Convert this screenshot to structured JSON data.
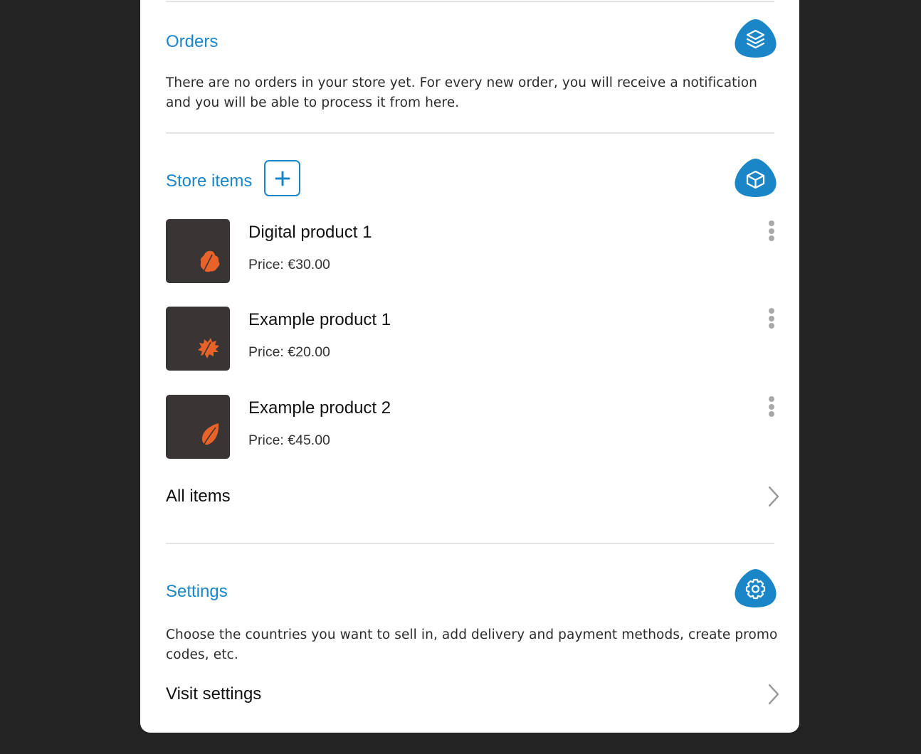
{
  "colors": {
    "accent": "#1a86c8",
    "thumb_bg": "#393534",
    "leaf": "#e8622a",
    "background": "#232323"
  },
  "orders": {
    "title": "Orders",
    "icon": "layers-icon",
    "description": "There are no orders in your store yet. For every new order, you will receive a notification and you will be able to process it from here."
  },
  "store_items": {
    "title": "Store items",
    "add_icon": "plus-icon",
    "icon": "box-icon",
    "items": [
      {
        "name": "Digital product 1",
        "price": "Price: €30.00",
        "thumb_icon": "oak-leaf-icon"
      },
      {
        "name": "Example product 1",
        "price": "Price: €20.00",
        "thumb_icon": "maple-leaf-icon"
      },
      {
        "name": "Example product 2",
        "price": "Price: €45.00",
        "thumb_icon": "leaf-icon"
      }
    ],
    "all_items_label": "All items"
  },
  "settings": {
    "title": "Settings",
    "icon": "gear-icon",
    "description": "Choose the countries you want to sell in, add delivery and payment methods, create promo codes, etc.",
    "visit_label": "Visit settings"
  }
}
